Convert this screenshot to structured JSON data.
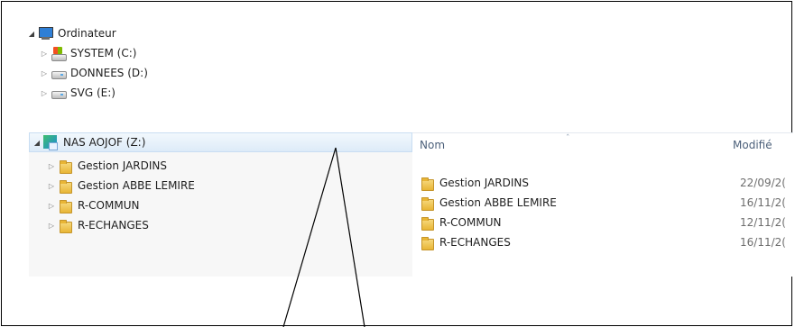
{
  "tree": {
    "computer": {
      "label": "Ordinateur",
      "icon": "computer-icon"
    },
    "drives": [
      {
        "label": "SYSTEM (C:)",
        "icon": "system-drive-icon"
      },
      {
        "label": "DONNEES (D:)",
        "icon": "hard-drive-icon"
      },
      {
        "label": "SVG (E:)",
        "icon": "hard-drive-icon"
      }
    ],
    "nas": {
      "label": "NAS AOJOF (Z:)",
      "icon": "network-drive-icon"
    },
    "folders": [
      {
        "label": "Gestion  JARDINS"
      },
      {
        "label": "Gestion ABBE LEMIRE"
      },
      {
        "label": "R-COMMUN"
      },
      {
        "label": "R-ECHANGES"
      }
    ]
  },
  "list": {
    "headers": {
      "name": "Nom",
      "modified": "Modifié"
    },
    "rows": [
      {
        "name": "Gestion  JARDINS",
        "modified": "22/09/2("
      },
      {
        "name": "Gestion ABBE LEMIRE",
        "modified": "16/11/2("
      },
      {
        "name": "R-COMMUN",
        "modified": "12/11/2("
      },
      {
        "name": "R-ECHANGES",
        "modified": "16/11/2("
      }
    ]
  },
  "colors": {
    "selection": "#ddebf8",
    "header_text": "#4c607a",
    "border": "#000000"
  }
}
